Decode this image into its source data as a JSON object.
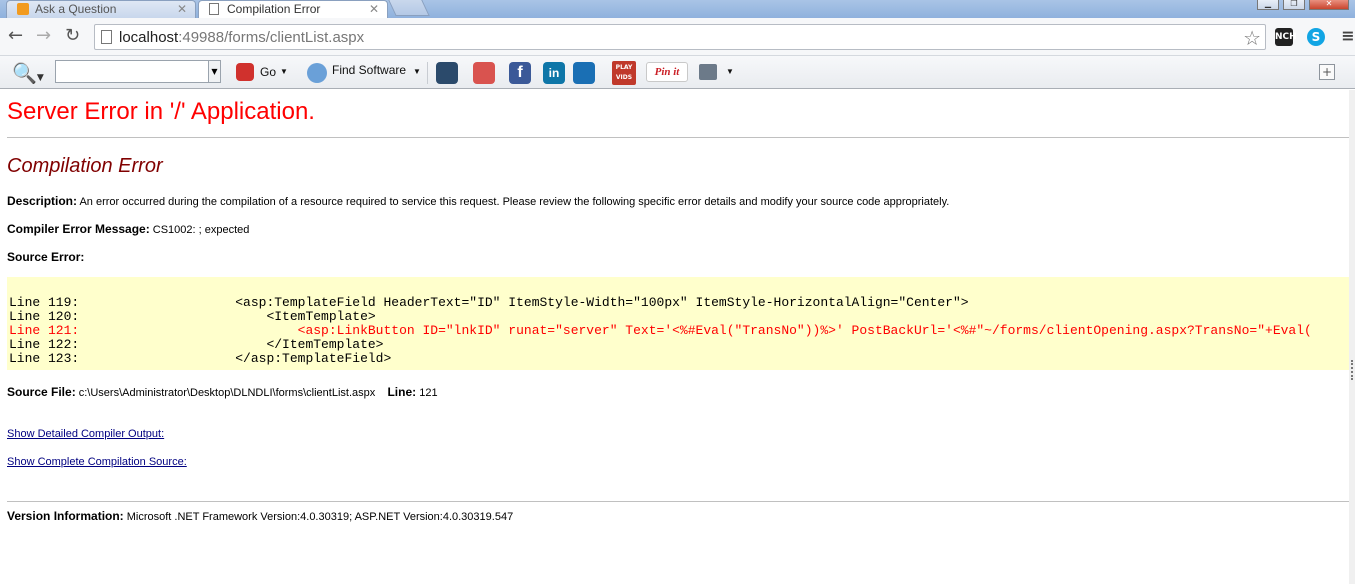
{
  "browser": {
    "tabs": [
      {
        "label": "Ask a Question",
        "active": false
      },
      {
        "label": "Compilation Error",
        "active": true
      }
    ],
    "address": {
      "host": "localhost",
      "rest": ":49988/forms/clientList.aspx"
    },
    "extensions": {
      "nch": "NCH",
      "skype": "S"
    }
  },
  "toolbar": {
    "go_label": "Go",
    "find_software_label": "Find Software",
    "play_vids_label": "PLAY VIDS",
    "pinit_label": "Pin it"
  },
  "page": {
    "server_error_title": "Server Error in '/' Application.",
    "compilation_error_title": "Compilation Error",
    "description_label": "Description:",
    "description_text": "An error occurred during the compilation of a resource required to service this request. Please review the following specific error details and modify your source code appropriately.",
    "compiler_msg_label": "Compiler Error Message:",
    "compiler_msg_text": "CS1002: ; expected",
    "source_error_label": "Source Error:",
    "source_lines": [
      {
        "num": "Line 119:",
        "code": "                    <asp:TemplateField HeaderText=\"ID\" ItemStyle-Width=\"100px\" ItemStyle-HorizontalAlign=\"Center\">",
        "error": false
      },
      {
        "num": "Line 120:",
        "code": "                        <ItemTemplate>",
        "error": false
      },
      {
        "num": "Line 121:",
        "code": "                            <asp:LinkButton ID=\"lnkID\" runat=\"server\" Text='<%#Eval(\"TransNo\"))%>' PostBackUrl='<%#\"~/forms/clientOpening.aspx?TransNo=\"+Eval(",
        "error": true
      },
      {
        "num": "Line 122:",
        "code": "                        </ItemTemplate>",
        "error": false
      },
      {
        "num": "Line 123:",
        "code": "                    </asp:TemplateField>",
        "error": false
      }
    ],
    "source_file_label": "Source File:",
    "source_file_text": "c:\\Users\\Administrator\\Desktop\\DLNDLI\\forms\\clientList.aspx",
    "line_label": "Line:",
    "line_value": "121",
    "show_detailed_link": "Show Detailed Compiler Output:",
    "show_complete_link": "Show Complete Compilation Source:",
    "version_label": "Version Information:",
    "version_text": "Microsoft .NET Framework Version:4.0.30319; ASP.NET Version:4.0.30319.547"
  }
}
